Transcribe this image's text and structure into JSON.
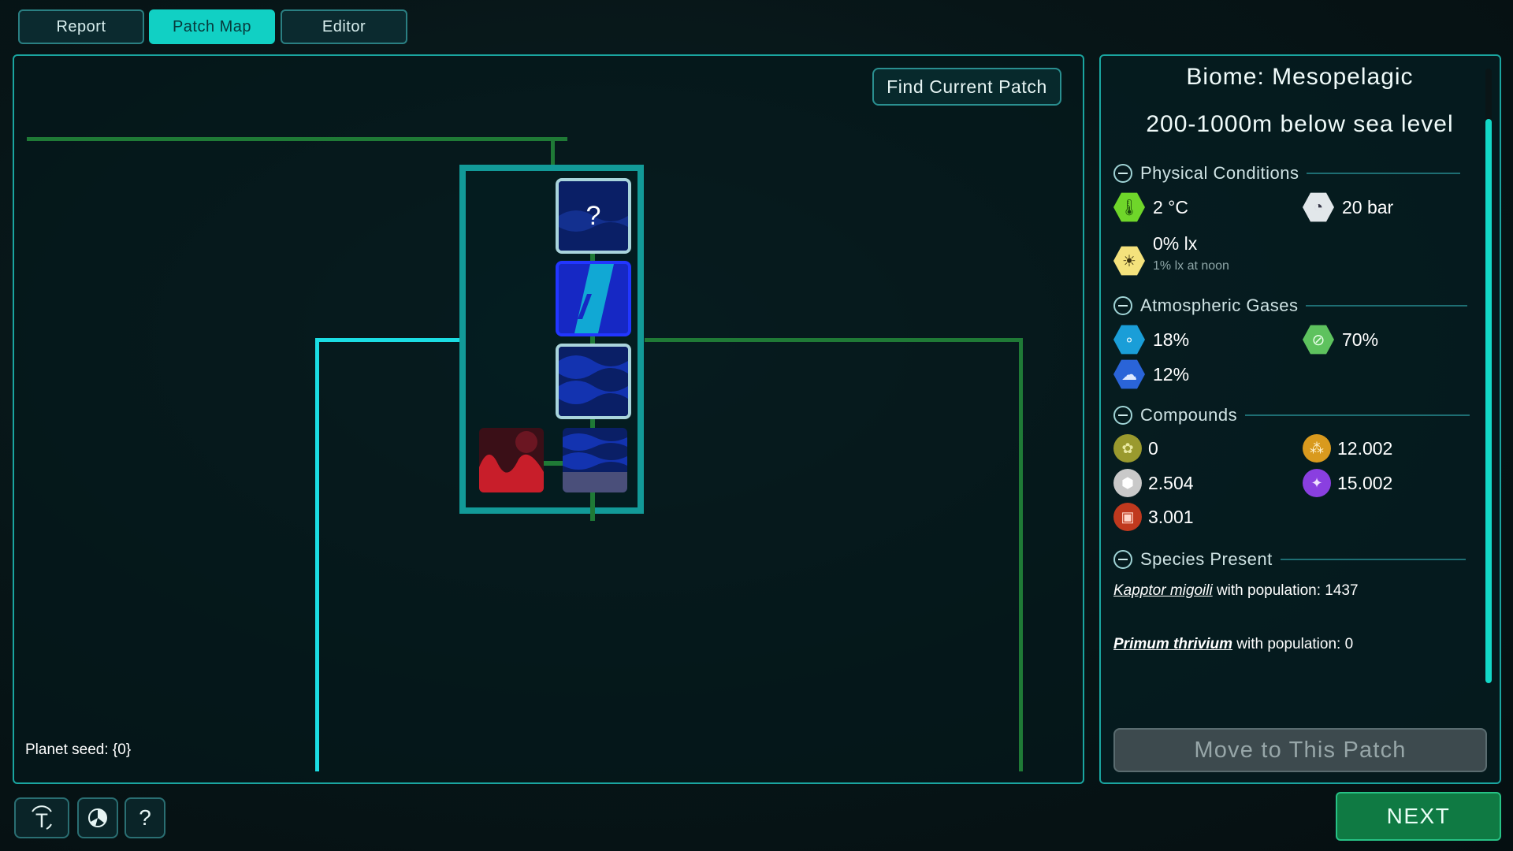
{
  "tabs": [
    {
      "label": "Report",
      "active": false
    },
    {
      "label": "Patch Map",
      "active": true
    },
    {
      "label": "Editor",
      "active": false
    }
  ],
  "map": {
    "find_button": "Find Current Patch",
    "planet_seed": "Planet seed: {0}",
    "unknown_patch_symbol": "?"
  },
  "info": {
    "biome_title": "Biome: Mesopelagic",
    "depth": "200-1000m below sea level",
    "physical": {
      "label": "Physical Conditions",
      "temperature": "2 °C",
      "pressure": "20 bar",
      "light": "0% lx",
      "light_noon": "1% lx at noon"
    },
    "gases": {
      "label": "Atmospheric Gases",
      "oxygen": "18%",
      "nitrogen": "70%",
      "co2": "12%"
    },
    "compounds": {
      "label": "Compounds",
      "glucose": "0",
      "ammonia": "12.002",
      "phosphate": "2.504",
      "hydrogen_sulfide": "15.002",
      "iron": "3.001"
    },
    "species": {
      "label": "Species Present",
      "items": [
        {
          "name": "Kapptor migoili",
          "text": "with population: 1437"
        },
        {
          "name": "Primum thrivium",
          "text": "with population: 0"
        }
      ]
    },
    "move_button": "Move to This Patch"
  },
  "footer": {
    "next_button": "NEXT",
    "help_symbol": "?"
  },
  "colors": {
    "accent": "#11d0c4",
    "map_line_green": "#1f7a36",
    "map_line_cyan": "#1bdde3",
    "next_green": "#0f7a43"
  },
  "icons": [
    "temperature-icon",
    "pressure-icon",
    "light-icon",
    "oxygen-icon",
    "nitrogen-icon",
    "co2-icon",
    "glucose-icon",
    "ammonia-icon",
    "phosphate-icon",
    "hydrogen-sulfide-icon",
    "iron-icon",
    "text-icon",
    "theme-icon"
  ]
}
